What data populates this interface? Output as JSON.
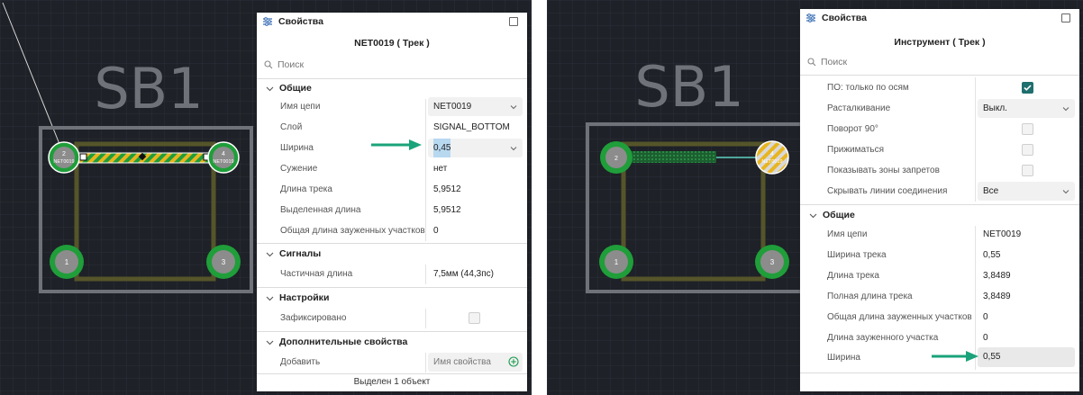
{
  "left": {
    "board_label": "SB1",
    "pads": [
      {
        "number": "2",
        "net": "NET0019"
      },
      {
        "number": "4",
        "net": "NET0019"
      },
      {
        "number": "1"
      },
      {
        "number": "3"
      }
    ],
    "panel": {
      "title": "Свойства",
      "object": "NET0019 ( Трек )",
      "search_placeholder": "Поиск",
      "sections": {
        "general": "Общие",
        "signals": "Сигналы",
        "settings": "Настройки",
        "extra": "Дополнительные свойства"
      },
      "rows": {
        "net_name": {
          "label": "Имя цепи",
          "value": "NET0019"
        },
        "layer": {
          "label": "Слой",
          "value": "SIGNAL_BOTTOM"
        },
        "width": {
          "label": "Ширина",
          "value": "0,45"
        },
        "taper": {
          "label": "Сужение",
          "value": "нет"
        },
        "track_length": {
          "label": "Длина трека",
          "value": "5,9512"
        },
        "selected_length": {
          "label": "Выделенная длина",
          "value": "5,9512"
        },
        "narrowed_total": {
          "label": "Общая длина зауженных участков",
          "value": "0"
        },
        "partial_length": {
          "label": "Частичная длина",
          "value": "7,5мм (44,3пс)"
        },
        "fixed": {
          "label": "Зафиксировано",
          "checked": false
        },
        "add": {
          "label": "Добавить",
          "placeholder": "Имя свойства"
        }
      },
      "footer": "Выделен 1 объект"
    }
  },
  "right": {
    "board_label": "SB1",
    "pads": [
      {
        "number": "2"
      },
      {
        "number": "4",
        "net": "NET0019"
      },
      {
        "number": "1"
      },
      {
        "number": "3"
      }
    ],
    "panel": {
      "title": "Свойства",
      "object": "Инструмент ( Трек )",
      "search_placeholder": "Поиск",
      "rows": {
        "axis_only": {
          "label": "ПО: только по осям",
          "checked": true
        },
        "push": {
          "label": "Расталкивание",
          "value": "Выкл."
        },
        "rotate90": {
          "label": "Поворот 90°",
          "checked": false
        },
        "hug": {
          "label": "Прижиматься",
          "checked": false
        },
        "show_keepouts": {
          "label": "Показывать зоны запретов",
          "checked": false
        },
        "hide_ratsnest": {
          "label": "Скрывать линии соединения",
          "value": "Все"
        }
      },
      "general_section": "Общие",
      "general_rows": {
        "net_name": {
          "label": "Имя цепи",
          "value": "NET0019"
        },
        "track_width": {
          "label": "Ширина трека",
          "value": "0,55"
        },
        "track_length": {
          "label": "Длина трека",
          "value": "3,8489"
        },
        "full_length": {
          "label": "Полная длина трека",
          "value": "3,8489"
        },
        "narrowed_total": {
          "label": "Общая длина зауженных участков",
          "value": "0"
        },
        "narrowed_segment": {
          "label": "Длина зауженного участка",
          "value": "0"
        },
        "width": {
          "label": "Ширина",
          "value": "0,55"
        }
      }
    }
  },
  "colors": {
    "canvas_bg": "#1e2127",
    "grid": "#2c3038",
    "board_outline": "#6f7278",
    "track": "#55552a",
    "pad_green": "#1f9e3a",
    "pad_gray": "#8c8c8c",
    "highlight_yellow": "#e8b520",
    "accent_teal": "#1aa37a",
    "checkbox_on": "#1f6f6e"
  },
  "icons": [
    "properties-icon",
    "maximize-icon",
    "search-icon",
    "chevron-down-icon",
    "plus-circle-icon",
    "check-icon",
    "arrow-right-icon"
  ]
}
